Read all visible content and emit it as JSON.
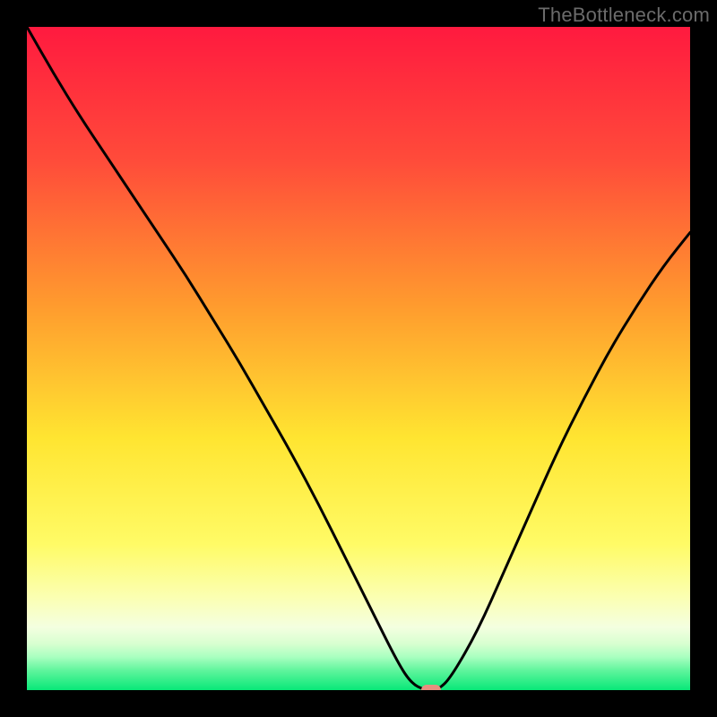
{
  "watermark": "TheBottleneck.com",
  "colors": {
    "frame": "#000000",
    "curve": "#000000",
    "marker": "#e78f7f",
    "gradient_stops": [
      {
        "pct": 0,
        "color": "#ff1a3f"
      },
      {
        "pct": 20,
        "color": "#ff4b3a"
      },
      {
        "pct": 42,
        "color": "#ff9b2e"
      },
      {
        "pct": 62,
        "color": "#ffe531"
      },
      {
        "pct": 78,
        "color": "#fffb66"
      },
      {
        "pct": 86,
        "color": "#fbffb2"
      },
      {
        "pct": 90.5,
        "color": "#f4ffe0"
      },
      {
        "pct": 93,
        "color": "#d8ffd0"
      },
      {
        "pct": 95,
        "color": "#a9ffc0"
      },
      {
        "pct": 97,
        "color": "#61f59d"
      },
      {
        "pct": 100,
        "color": "#08e878"
      }
    ]
  },
  "chart_data": {
    "type": "line",
    "title": "",
    "xlabel": "",
    "ylabel": "",
    "xlim": [
      0,
      100
    ],
    "ylim": [
      0,
      100
    ],
    "series": [
      {
        "name": "bottleneck-curve",
        "x": [
          0,
          4,
          8,
          12,
          16,
          20,
          24,
          28,
          32,
          36,
          40,
          44,
          48,
          52,
          56,
          58,
          60,
          62,
          64,
          68,
          72,
          76,
          80,
          84,
          88,
          92,
          96,
          100
        ],
        "y": [
          100,
          93,
          86.5,
          80.5,
          74.5,
          68.5,
          62.5,
          56,
          49.5,
          42.5,
          35.5,
          28,
          20,
          12,
          4,
          1,
          0,
          0,
          2,
          9,
          18,
          27,
          36,
          44,
          51.5,
          58,
          64,
          69
        ]
      }
    ],
    "marker": {
      "x": 61,
      "y": 0
    },
    "grid": false,
    "legend": false
  }
}
